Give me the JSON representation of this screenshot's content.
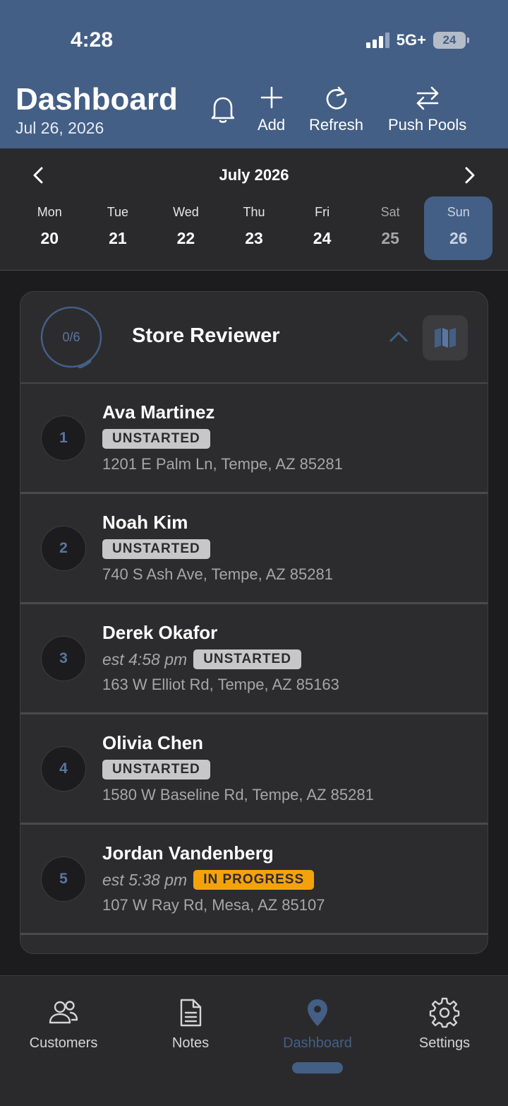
{
  "status_bar": {
    "time": "4:28",
    "network": "5G+",
    "battery": "24"
  },
  "header": {
    "title": "Dashboard",
    "date": "Jul 26, 2026",
    "actions": {
      "add": "Add",
      "refresh": "Refresh",
      "push_pools": "Push Pools"
    }
  },
  "calendar": {
    "month_label": "July 2026",
    "days": [
      {
        "name": "Mon",
        "num": "20"
      },
      {
        "name": "Tue",
        "num": "21"
      },
      {
        "name": "Wed",
        "num": "22"
      },
      {
        "name": "Thu",
        "num": "23"
      },
      {
        "name": "Fri",
        "num": "24"
      },
      {
        "name": "Sat",
        "num": "25"
      },
      {
        "name": "Sun",
        "num": "26"
      }
    ],
    "selected_day": "Sun 26"
  },
  "route_card": {
    "progress_label": "0/6",
    "progress_fraction": 0.0,
    "title": "Store Reviewer",
    "stops": [
      {
        "num": "1",
        "name": "Ava Martinez",
        "est": "",
        "status": "UNSTARTED",
        "address": "1201 E Palm Ln, Tempe, AZ 85281"
      },
      {
        "num": "2",
        "name": "Noah Kim",
        "est": "",
        "status": "UNSTARTED",
        "address": "740 S Ash Ave, Tempe, AZ 85281"
      },
      {
        "num": "3",
        "name": "Derek Okafor",
        "est": "est 4:58 pm",
        "status": "UNSTARTED",
        "address": "163 W Elliot Rd, Tempe, AZ 85163"
      },
      {
        "num": "4",
        "name": "Olivia Chen",
        "est": "",
        "status": "UNSTARTED",
        "address": "1580 W Baseline Rd, Tempe, AZ 85281"
      },
      {
        "num": "5",
        "name": "Jordan Vandenberg",
        "est": "est 5:38 pm",
        "status": "IN PROGRESS",
        "address": "107 W Ray Rd, Mesa, AZ 85107"
      }
    ]
  },
  "tabbar": {
    "customers": "Customers",
    "notes": "Notes",
    "dashboard": "Dashboard",
    "settings": "Settings",
    "active": "Dashboard"
  },
  "colors": {
    "accent": "#445f86",
    "in_progress": "#f4a20c",
    "unstarted": "#c7c7c9",
    "background": "#1c1c1e"
  }
}
